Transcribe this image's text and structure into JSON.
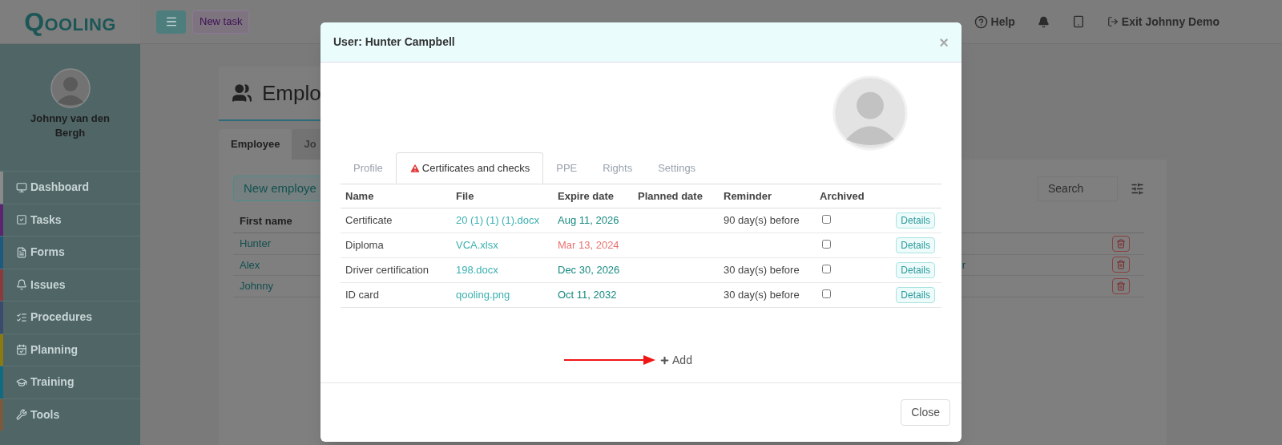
{
  "logo": {
    "initial": "Q",
    "rest": "OOLING"
  },
  "topbar": {
    "new_task": "New task",
    "help": "Help",
    "exit": "Exit Johnny Demo"
  },
  "user": {
    "name": "Johnny van den Bergh"
  },
  "sidebar": {
    "items": [
      {
        "label": "Dashboard",
        "color": "#8a8a8a"
      },
      {
        "label": "Tasks",
        "color": "#5a2470"
      },
      {
        "label": "Forms",
        "color": "#1d5a80"
      },
      {
        "label": "Issues",
        "color": "#8a3a3a"
      },
      {
        "label": "Procedures",
        "color": "#3a4c6e"
      },
      {
        "label": "Planning",
        "color": "#8a7a10"
      },
      {
        "label": "Training",
        "color": "#106a80"
      },
      {
        "label": "Tools",
        "color": "#7a5a3a"
      }
    ]
  },
  "page": {
    "title": "Emplo",
    "tabs": [
      {
        "label": "Employee",
        "selected": true
      },
      {
        "label": "Jo",
        "selected": false
      }
    ],
    "new_button": "New employe",
    "search": {
      "placeholder": "Search"
    },
    "table": {
      "columns": [
        "First name"
      ],
      "rows": [
        {
          "first_name": "Hunter",
          "column_2": ""
        },
        {
          "first_name": "Alex",
          "column_2": "r"
        },
        {
          "first_name": "Johnny",
          "column_2": ""
        }
      ]
    }
  },
  "modal": {
    "title": "User: Hunter Campbell",
    "close_symbol": "×",
    "tabs": [
      {
        "label": "Profile",
        "selected": false,
        "warning": false
      },
      {
        "label": "Certificates and checks",
        "selected": true,
        "warning": true
      },
      {
        "label": "PPE",
        "selected": false,
        "warning": false
      },
      {
        "label": "Rights",
        "selected": false,
        "warning": false
      },
      {
        "label": "Settings",
        "selected": false,
        "warning": false
      }
    ],
    "columns": [
      "Name",
      "File",
      "Expire date",
      "Planned date",
      "Reminder",
      "Archived"
    ],
    "rows": [
      {
        "name": "Certificate",
        "file": "20 (1) (1) (1).docx",
        "expire": "Aug 11, 2026",
        "expired": false,
        "planned": "",
        "reminder": "90 day(s) before",
        "archived": false,
        "action": "Details"
      },
      {
        "name": "Diploma",
        "file": "VCA.xlsx",
        "expire": "Mar 13, 2024",
        "expired": true,
        "planned": "",
        "reminder": "",
        "archived": false,
        "action": "Details"
      },
      {
        "name": "Driver certification",
        "file": "198.docx",
        "expire": "Dec 30, 2026",
        "expired": false,
        "planned": "",
        "reminder": "30 day(s) before",
        "archived": false,
        "action": "Details"
      },
      {
        "name": "ID card",
        "file": "qooling.png",
        "expire": "Oct 11, 2032",
        "expired": false,
        "planned": "",
        "reminder": "30 day(s) before",
        "archived": false,
        "action": "Details"
      }
    ],
    "add": "Add",
    "close": "Close"
  }
}
